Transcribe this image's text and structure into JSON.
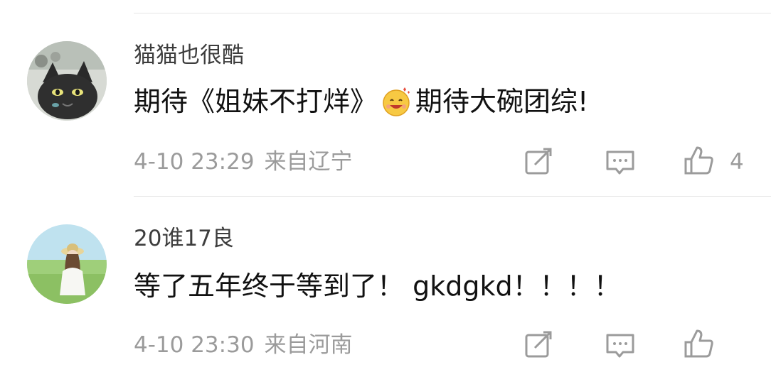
{
  "comments": [
    {
      "username": "猫猫也很酷",
      "text_before": "期待《姐妹不打烊》",
      "text_after": "期待大碗团综!",
      "emoji_icon": "smiling-face-hearts-icon",
      "time": "4-10 23:29",
      "location": "来自辽宁",
      "like_count": "4",
      "avatar_icon": "black-cat-avatar-icon"
    },
    {
      "username": "20谁17良",
      "text": "等了五年终于等到了！ gkdgkd！！！！",
      "time": "4-10 23:30",
      "location": "来自河南",
      "like_count": "",
      "avatar_icon": "girl-straw-hat-avatar-icon"
    }
  ],
  "icons": {
    "repost": "share-edit-icon",
    "comment": "comment-bubble-icon",
    "like": "thumbs-up-icon"
  },
  "colors": {
    "meta_text": "#9b9b9b",
    "divider": "#e6e6e6"
  }
}
